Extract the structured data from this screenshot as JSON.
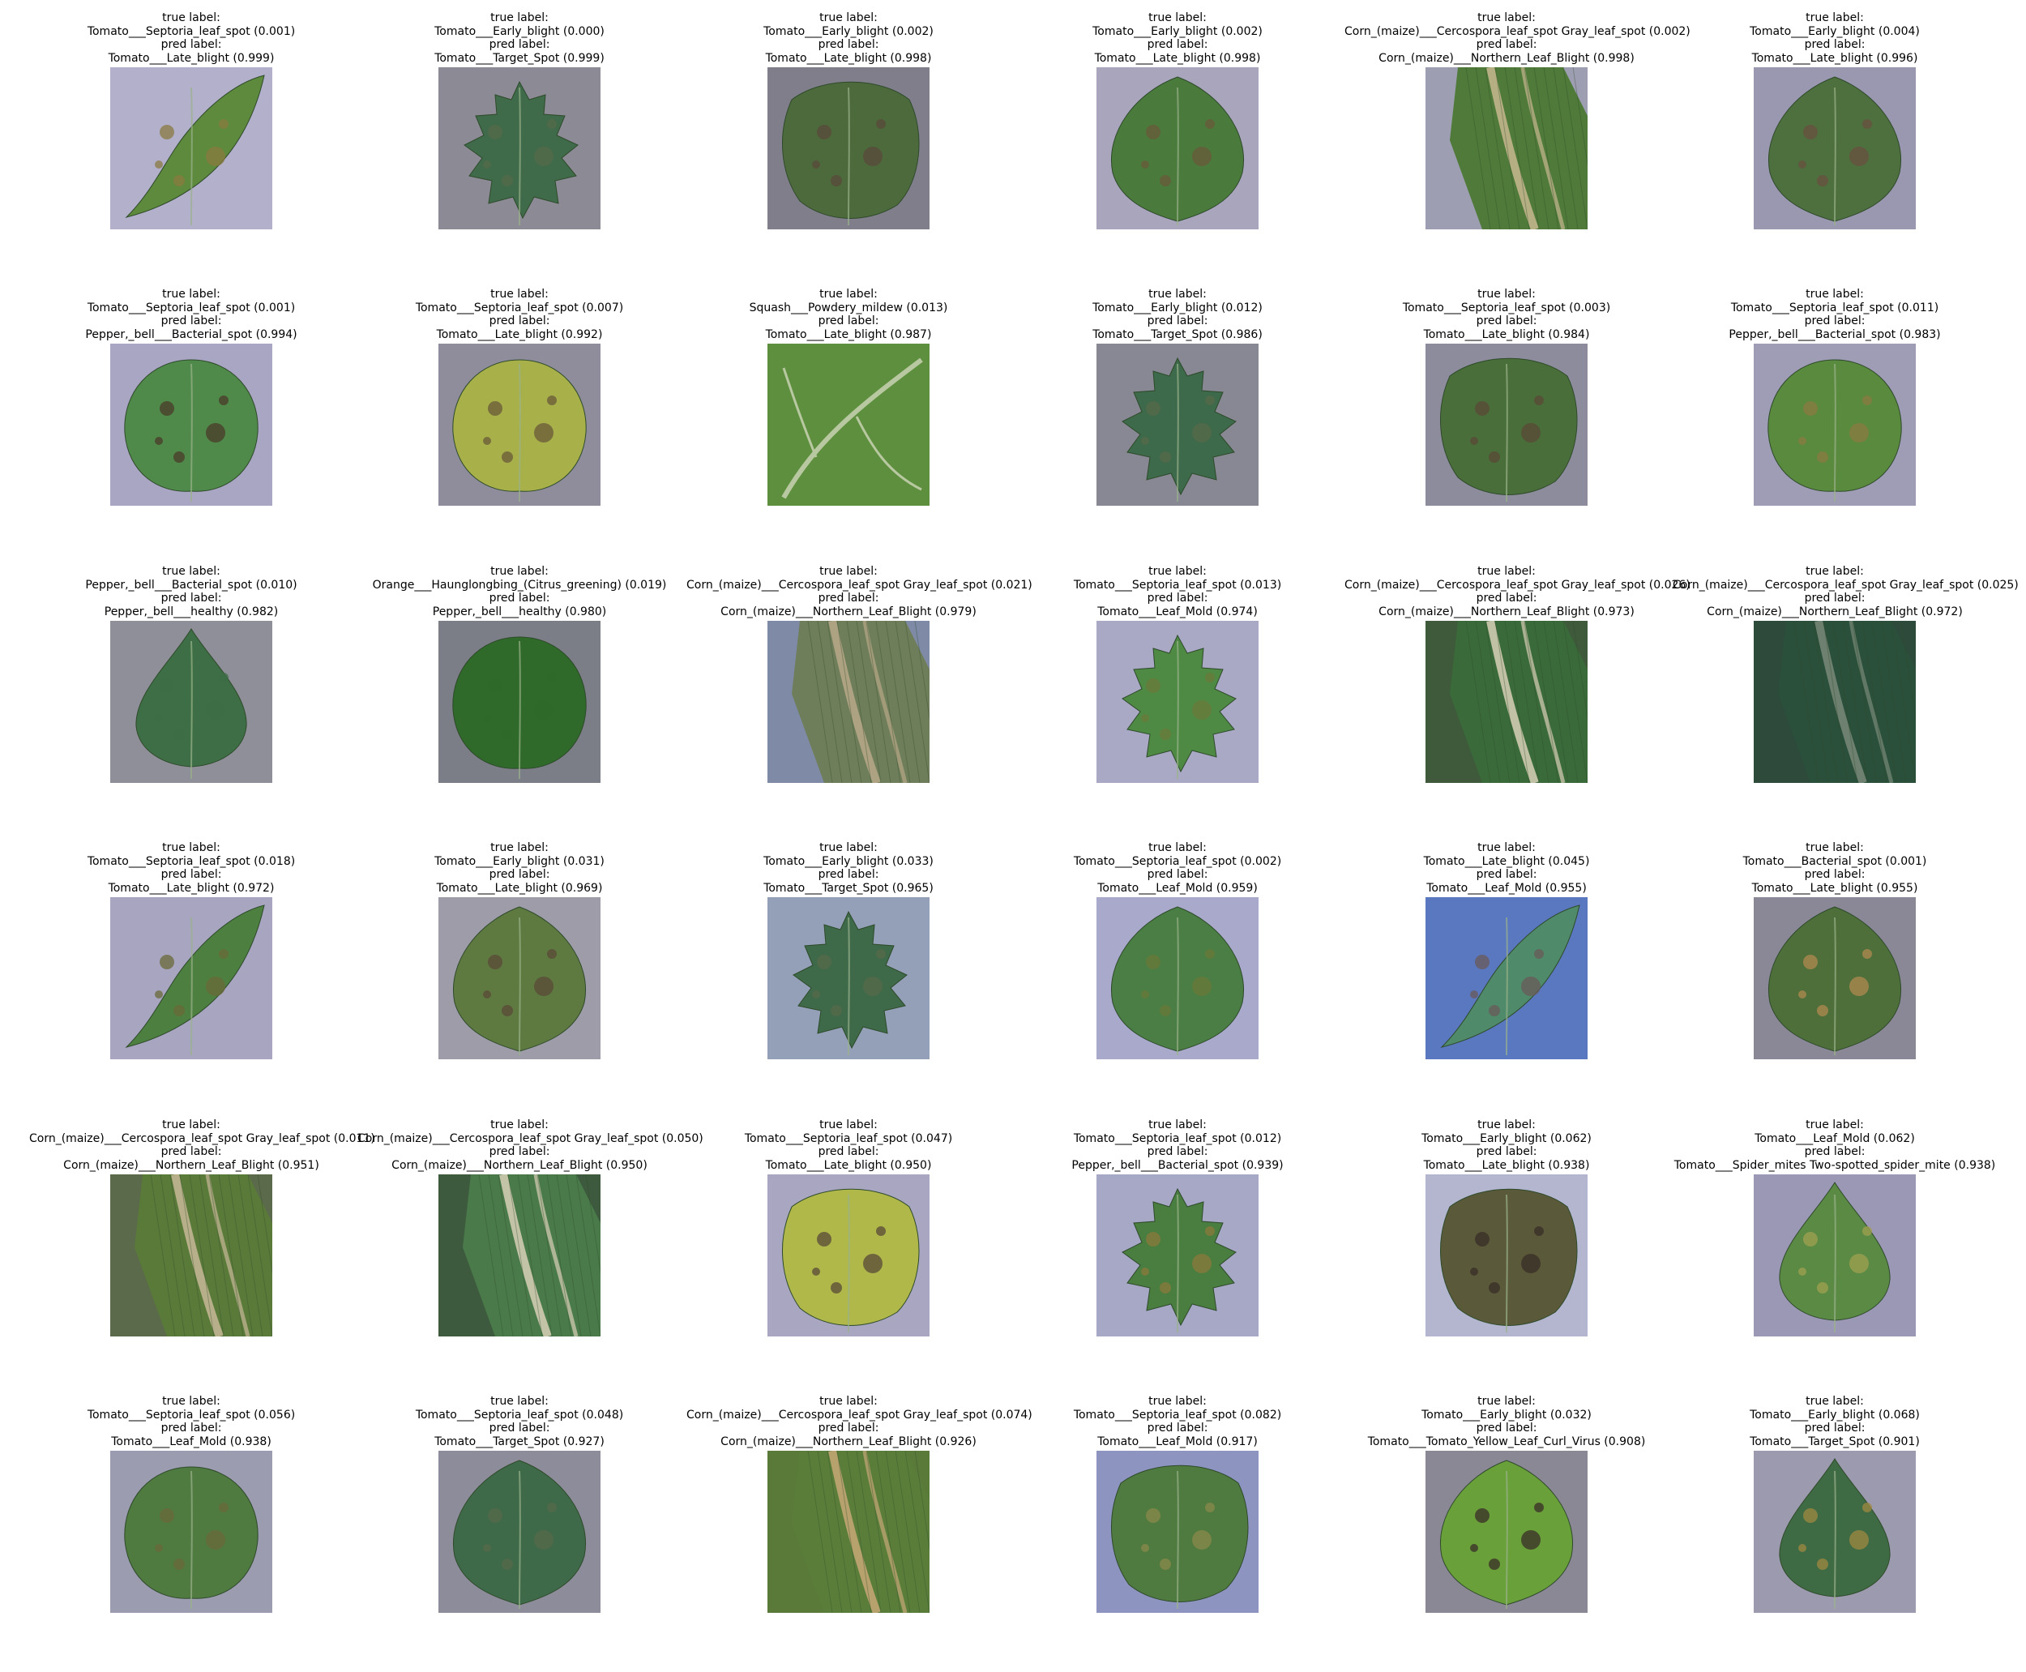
{
  "title_line": "true label:",
  "pred_line": "pred label:",
  "panels": [
    {
      "true_label": "Tomato___Septoria_leaf_spot (0.001)",
      "pred_label": "Tomato___Late_blight (0.999)",
      "bg": "#b3b0cb",
      "leaf": "#5d8a3c",
      "leaf_shape": "narrow-leaf",
      "disease": "#8a7a40"
    },
    {
      "true_label": "Tomato___Early_blight (0.000)",
      "pred_label": "Tomato___Target_Spot (0.999)",
      "bg": "#8c8b95",
      "leaf": "#3f6b4a",
      "leaf_shape": "serrated-leaf",
      "disease": "#556a4a"
    },
    {
      "true_label": "Tomato___Early_blight (0.002)",
      "pred_label": "Tomato___Late_blight (0.998)",
      "bg": "#7f7e8a",
      "leaf": "#4d6a3c",
      "leaf_shape": "blighted-leaf",
      "disease": "#5a4a3a"
    },
    {
      "true_label": "Tomato___Early_blight (0.002)",
      "pred_label": "Tomato___Late_blight (0.998)",
      "bg": "#a8a5bd",
      "leaf": "#4a7a3c",
      "leaf_shape": "broad-leaf",
      "disease": "#6a5a3a"
    },
    {
      "true_label": "Corn_(maize)___Cercospora_leaf_spot Gray_leaf_spot (0.002)",
      "pred_label": "Corn_(maize)___Northern_Leaf_Blight (0.998)",
      "bg": "#9e9eb2",
      "leaf": "#4f7a3a",
      "leaf_shape": "corn-leaf",
      "disease": "#c8b890"
    },
    {
      "true_label": "Tomato___Early_blight (0.004)",
      "pred_label": "Tomato___Late_blight (0.996)",
      "bg": "#9a97b0",
      "leaf": "#4e6f3e",
      "leaf_shape": "broad-leaf",
      "disease": "#6a5040"
    },
    {
      "true_label": "Tomato___Septoria_leaf_spot (0.001)",
      "pred_label": "Pepper,_bell___Bacterial_spot (0.994)",
      "bg": "#a9a6c4",
      "leaf": "#4f8a4a",
      "leaf_shape": "round-leaf",
      "disease": "#4a3a2a"
    },
    {
      "true_label": "Tomato___Septoria_leaf_spot (0.007)",
      "pred_label": "Tomato___Late_blight (0.992)",
      "bg": "#8f8d9c",
      "leaf": "#a8b04a",
      "leaf_shape": "round-leaf",
      "disease": "#6a5a3a"
    },
    {
      "true_label": "Squash___Powdery_mildew (0.013)",
      "pred_label": "Tomato___Late_blight (0.987)",
      "bg": "#6f8a4a",
      "leaf": "#5e8f3e",
      "leaf_shape": "fill-leaf",
      "disease": "#b8c8a0"
    },
    {
      "true_label": "Tomato___Early_blight (0.012)",
      "pred_label": "Tomato___Target_Spot (0.986)",
      "bg": "#878894",
      "leaf": "#3d6a4a",
      "leaf_shape": "serrated-leaf",
      "disease": "#556a4a"
    },
    {
      "true_label": "Tomato___Septoria_leaf_spot (0.003)",
      "pred_label": "Tomato___Late_blight (0.984)",
      "bg": "#8d8c9c",
      "leaf": "#4a6e3a",
      "leaf_shape": "blighted-leaf",
      "disease": "#5a4a38"
    },
    {
      "true_label": "Tomato___Septoria_leaf_spot (0.011)",
      "pred_label": "Pepper,_bell___Bacterial_spot (0.983)",
      "bg": "#9f9cb6",
      "leaf": "#5a8a3e",
      "leaf_shape": "round-leaf",
      "disease": "#8a7a40"
    },
    {
      "true_label": "Pepper,_bell___Bacterial_spot (0.010)",
      "pred_label": "Pepper,_bell___healthy (0.982)",
      "bg": "#8e8f98",
      "leaf": "#3e6e45",
      "leaf_shape": "pointed-leaf",
      "disease": "#3e6e45"
    },
    {
      "true_label": "Orange___Haunglongbing_(Citrus_greening) (0.019)",
      "pred_label": "Pepper,_bell___healthy (0.980)",
      "bg": "#7b7e86",
      "leaf": "#2f6a2a",
      "leaf_shape": "round-leaf",
      "disease": "#2f6a2a"
    },
    {
      "true_label": "Corn_(maize)___Cercospora_leaf_spot Gray_leaf_spot (0.021)",
      "pred_label": "Corn_(maize)___Northern_Leaf_Blight (0.979)",
      "bg": "#7e8aa6",
      "leaf": "#6f7e5a",
      "leaf_shape": "corn-leaf",
      "disease": "#b8a888"
    },
    {
      "true_label": "Tomato___Septoria_leaf_spot (0.013)",
      "pred_label": "Tomato___Leaf_Mold (0.974)",
      "bg": "#a9a9c6",
      "leaf": "#4f8a44",
      "leaf_shape": "serrated-leaf",
      "disease": "#6a7a3a"
    },
    {
      "true_label": "Corn_(maize)___Cercospora_leaf_spot Gray_leaf_spot (0.026)",
      "pred_label": "Corn_(maize)___Northern_Leaf_Blight (0.973)",
      "bg": "#3f5a3a",
      "leaf": "#3a6a3a",
      "leaf_shape": "corn-leaf",
      "disease": "#d8d0b8"
    },
    {
      "true_label": "Corn_(maize)___Cercospora_leaf_spot Gray_leaf_spot (0.025)",
      "pred_label": "Corn_(maize)___Northern_Leaf_Blight (0.972)",
      "bg": "#2e4a3a",
      "leaf": "#2a4f3a",
      "leaf_shape": "corn-leaf",
      "disease": "#7a8a7a"
    },
    {
      "true_label": "Tomato___Septoria_leaf_spot (0.018)",
      "pred_label": "Tomato___Late_blight (0.972)",
      "bg": "#a7a5c0",
      "leaf": "#4d8040",
      "leaf_shape": "narrow-leaf",
      "disease": "#6a6a3a"
    },
    {
      "true_label": "Tomato___Early_blight (0.031)",
      "pred_label": "Tomato___Late_blight (0.969)",
      "bg": "#9d9ca8",
      "leaf": "#5f7a40",
      "leaf_shape": "broad-leaf",
      "disease": "#5a4a38"
    },
    {
      "true_label": "Tomato___Early_blight (0.033)",
      "pred_label": "Tomato___Target_Spot (0.965)",
      "bg": "#94a0b8",
      "leaf": "#3e6a4a",
      "leaf_shape": "serrated-leaf",
      "disease": "#556a4a"
    },
    {
      "true_label": "Tomato___Septoria_leaf_spot (0.002)",
      "pred_label": "Tomato___Leaf_Mold (0.959)",
      "bg": "#a9aacb",
      "leaf": "#4a7e44",
      "leaf_shape": "broad-leaf",
      "disease": "#6a7a3a"
    },
    {
      "true_label": "Tomato___Late_blight (0.045)",
      "pred_label": "Tomato___Leaf_Mold (0.955)",
      "bg": "#5a78c0",
      "leaf": "#4f8a6a",
      "leaf_shape": "narrow-leaf",
      "disease": "#6a5a5a"
    },
    {
      "true_label": "Tomato___Bacterial_spot (0.001)",
      "pred_label": "Tomato___Late_blight (0.955)",
      "bg": "#8a8897",
      "leaf": "#4e6f3a",
      "leaf_shape": "broad-leaf",
      "disease": "#b08a50"
    },
    {
      "true_label": "Corn_(maize)___Cercospora_leaf_spot Gray_leaf_spot (0.011)",
      "pred_label": "Corn_(maize)___Northern_Leaf_Blight (0.951)",
      "bg": "#5a6a4a",
      "leaf": "#5a7a3a",
      "leaf_shape": "corn-leaf",
      "disease": "#c8b898"
    },
    {
      "true_label": "Corn_(maize)___Cercospora_leaf_spot Gray_leaf_spot (0.050)",
      "pred_label": "Corn_(maize)___Northern_Leaf_Blight (0.950)",
      "bg": "#3e5a3e",
      "leaf": "#4a7a4a",
      "leaf_shape": "corn-leaf",
      "disease": "#d8d0b8"
    },
    {
      "true_label": "Tomato___Septoria_leaf_spot (0.047)",
      "pred_label": "Tomato___Late_blight (0.950)",
      "bg": "#a8a6c0",
      "leaf": "#b0b84a",
      "leaf_shape": "blighted-leaf",
      "disease": "#5a4a3a"
    },
    {
      "true_label": "Tomato___Septoria_leaf_spot (0.012)",
      "pred_label": "Pepper,_bell___Bacterial_spot (0.939)",
      "bg": "#a6a8c6",
      "leaf": "#4a7e40",
      "leaf_shape": "serrated-leaf",
      "disease": "#8a7a3a"
    },
    {
      "true_label": "Tomato___Early_blight (0.062)",
      "pred_label": "Tomato___Late_blight (0.938)",
      "bg": "#b4b6d0",
      "leaf": "#5a5a3a",
      "leaf_shape": "blighted-leaf",
      "disease": "#3a2e28"
    },
    {
      "true_label": "Tomato___Leaf_Mold (0.062)",
      "pred_label": "Tomato___Spider_mites Two-spotted_spider_mite (0.938)",
      "bg": "#9a98b4",
      "leaf": "#5a8a44",
      "leaf_shape": "pointed-leaf",
      "disease": "#a0a050"
    },
    {
      "true_label": "Tomato___Septoria_leaf_spot (0.056)",
      "pred_label": "Tomato___Leaf_Mold (0.938)",
      "bg": "#9c9cb0",
      "leaf": "#4f7a40",
      "leaf_shape": "round-leaf",
      "disease": "#6a6a3a"
    },
    {
      "true_label": "Tomato___Septoria_leaf_spot (0.048)",
      "pred_label": "Tomato___Target_Spot (0.927)",
      "bg": "#8d8c9a",
      "leaf": "#3e6a4a",
      "leaf_shape": "broad-leaf",
      "disease": "#556a4a"
    },
    {
      "true_label": "Corn_(maize)___Cercospora_leaf_spot Gray_leaf_spot (0.074)",
      "pred_label": "Corn_(maize)___Northern_Leaf_Blight (0.926)",
      "bg": "#5a7a3a",
      "leaf": "#5a7e3a",
      "leaf_shape": "corn-leaf",
      "disease": "#c8a878"
    },
    {
      "true_label": "Tomato___Septoria_leaf_spot (0.082)",
      "pred_label": "Tomato___Leaf_Mold (0.917)",
      "bg": "#8e94c0",
      "leaf": "#4f7a40",
      "leaf_shape": "blighted-leaf",
      "disease": "#8a8a4a"
    },
    {
      "true_label": "Tomato___Early_blight (0.032)",
      "pred_label": "Tomato___Tomato_Yellow_Leaf_Curl_Virus (0.908)",
      "bg": "#8a8895",
      "leaf": "#6aa03a",
      "leaf_shape": "broad-leaf",
      "disease": "#3a2e28"
    },
    {
      "true_label": "Tomato___Early_blight (0.068)",
      "pred_label": "Tomato___Target_Spot (0.901)",
      "bg": "#9c9aae",
      "leaf": "#3e6a44",
      "leaf_shape": "pointed-leaf",
      "disease": "#a08a40"
    }
  ]
}
